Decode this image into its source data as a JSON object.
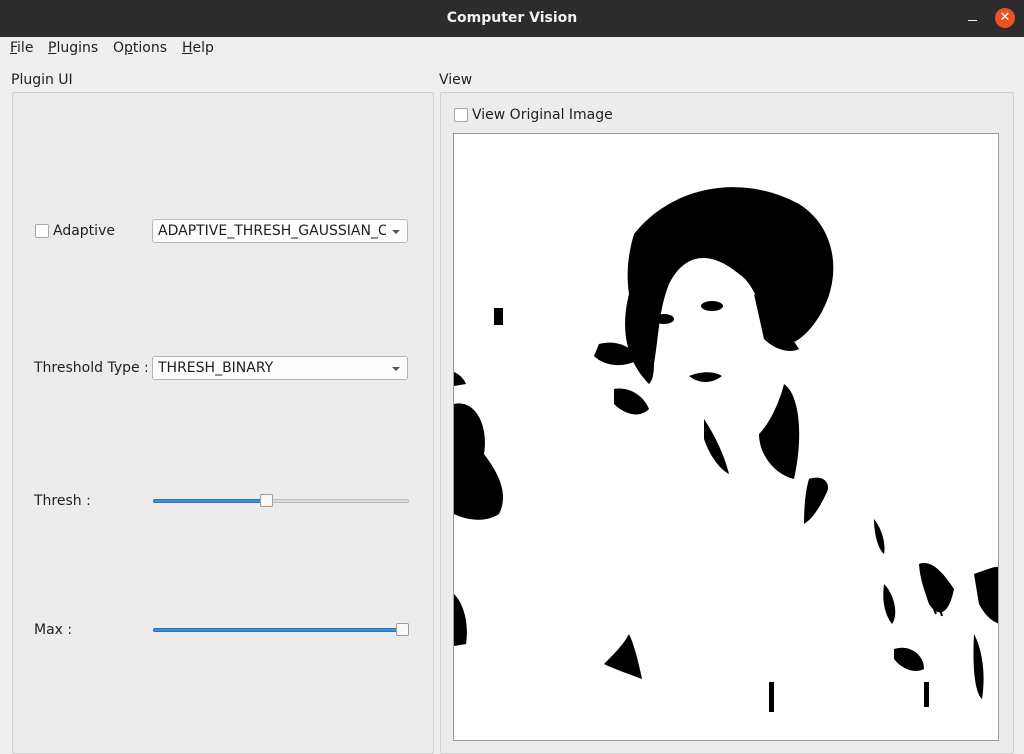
{
  "window": {
    "title": "Computer Vision"
  },
  "menu": {
    "file": {
      "mnemonic": "F",
      "rest": "ile"
    },
    "plugins": {
      "mnemonic": "P",
      "rest": "lugins"
    },
    "options": {
      "pre": "O",
      "mnemonic": "p",
      "rest": "tions"
    },
    "help": {
      "mnemonic": "H",
      "rest": "elp"
    }
  },
  "plugin_ui": {
    "title": "Plugin UI",
    "adaptive": {
      "label": "Adaptive",
      "checked": false
    },
    "adaptive_method": {
      "value": "ADAPTIVE_THRESH_GAUSSIAN_C"
    },
    "threshold_type": {
      "label": "Threshold Type :",
      "value": "THRESH_BINARY"
    },
    "thresh": {
      "label": "Thresh :",
      "level": 0.44
    },
    "max": {
      "label": "Max :",
      "level": 1.0
    }
  },
  "view": {
    "title": "View",
    "view_original": {
      "label": "View Original Image",
      "checked": false
    },
    "image": {
      "description_icon": "thresholded-image"
    }
  },
  "colors": {
    "accent": "#3d8fd6",
    "close": "#e95420",
    "titlebar": "#2c2c2c"
  }
}
